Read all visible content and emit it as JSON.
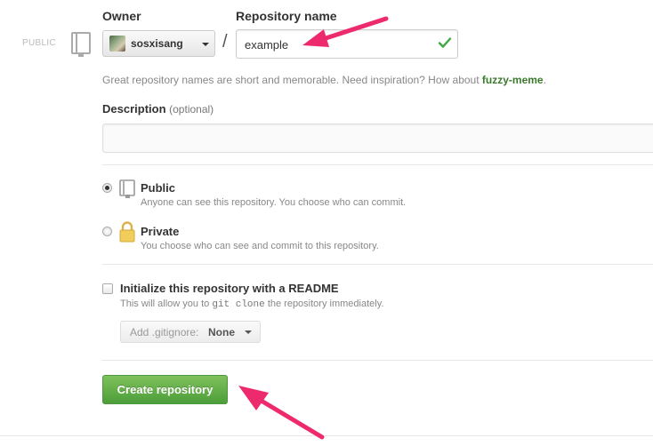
{
  "visibility_tag": "PUBLIC",
  "owner": {
    "label": "Owner",
    "selected": "sosxisang"
  },
  "repository_name": {
    "label": "Repository name",
    "value": "example",
    "valid": true
  },
  "separator": "/",
  "hint": {
    "text": "Great repository names are short and memorable. Need inspiration? How about",
    "suggestion": "fuzzy-meme",
    "suffix": "."
  },
  "description": {
    "label": "Description",
    "optional": "(optional)",
    "value": ""
  },
  "visibility": {
    "selected": "public",
    "public": {
      "title": "Public",
      "desc": "Anyone can see this repository. You choose who can commit."
    },
    "private": {
      "title": "Private",
      "desc": "You choose who can see and commit to this repository."
    }
  },
  "readme": {
    "checked": false,
    "label": "Initialize this repository with a README",
    "desc_prefix": "This will allow you to",
    "desc_code": "git clone",
    "desc_suffix": "the repository immediately."
  },
  "gitignore": {
    "label": "Add .gitignore:",
    "value": "None"
  },
  "submit": {
    "label": "Create repository"
  },
  "colors": {
    "accent_green": "#4c9e3a",
    "annotation_arrow": "#ee2a6e",
    "suggestion_green": "#3b7a2d"
  }
}
